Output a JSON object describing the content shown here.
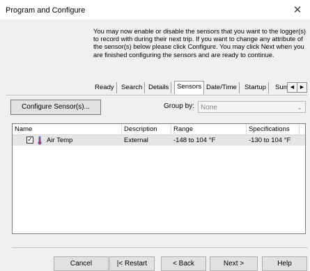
{
  "window": {
    "title": "Program and Configure",
    "close_glyph": "✕"
  },
  "instructions": "You may now enable or disable the sensors that you want to the logger(s) to record with during their next trip. If you want to change any attribute of the sensor(s) below please click Configure. You may click Next when you are finished configuring the sensors and are ready to continue.",
  "tabs": [
    {
      "label": "Ready"
    },
    {
      "label": "Search"
    },
    {
      "label": "Details"
    },
    {
      "label": "Sensors"
    },
    {
      "label": "Date/Time"
    },
    {
      "label": "Startup"
    },
    {
      "label": "Sum"
    }
  ],
  "active_tab": "Sensors",
  "tab_scroll": {
    "left": "◀",
    "right": "▶"
  },
  "toolbar": {
    "configure_label": "Configure Sensor(s)...",
    "group_by_label": "Group by:",
    "group_by_value": "None",
    "dropdown_glyph": "⌄"
  },
  "sensor_list": {
    "columns": [
      "Name",
      "Description",
      "Range",
      "Specifications"
    ],
    "rows": [
      {
        "checked": true,
        "check_glyph": "✓",
        "icon": "thermometer-icon",
        "name": "Air Temp",
        "description": "External",
        "range": "-148 to 104 °F",
        "specifications": "-130 to 104 °F"
      }
    ]
  },
  "footer": {
    "cancel_label": "Cancel",
    "restart_label": "|< Restart",
    "back_label": "< Back",
    "next_label": "Next >",
    "help_label": "Help"
  },
  "colors": {
    "window_bg": "#f0f0f0",
    "button_bg": "#e1e1e1",
    "selected_row": "#e5e5e5",
    "thermometer_red": "#d9262c",
    "thermometer_blue": "#3a7bd5"
  }
}
